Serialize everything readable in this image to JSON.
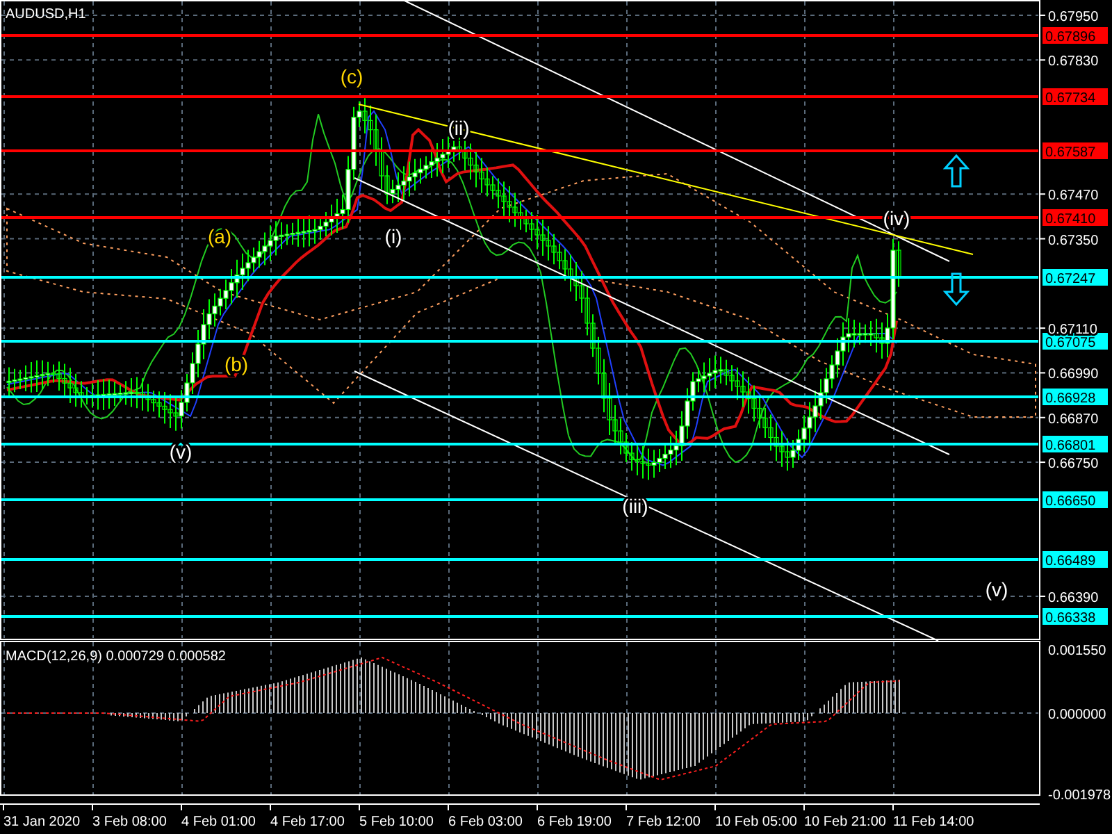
{
  "chart": {
    "title": "AUDUSD,H1"
  },
  "price_axis": [
    "0.67950",
    "0.67830",
    "0.67470",
    "0.67350",
    "0.67110",
    "0.66990",
    "0.66870",
    "0.66750",
    "0.66390"
  ],
  "price_levels": [
    {
      "label": "0.67896",
      "color": "#ff0000"
    },
    {
      "label": "0.67734",
      "color": "#ff0000"
    },
    {
      "label": "0.67587",
      "color": "#ff0000"
    },
    {
      "label": "0.67410",
      "color": "#ff0000"
    },
    {
      "label": "0.67247",
      "color": "#00ffff"
    },
    {
      "label": "0.67075",
      "color": "#00ffff"
    },
    {
      "label": "0.66928",
      "color": "#00ffff"
    },
    {
      "label": "0.66801",
      "color": "#00ffff"
    },
    {
      "label": "0.66650",
      "color": "#00ffff"
    },
    {
      "label": "0.66489",
      "color": "#00ffff"
    },
    {
      "label": "0.66338",
      "color": "#00ffff"
    }
  ],
  "wave_labels": [
    {
      "label": "(c)",
      "color": "#ffd700"
    },
    {
      "label": "(a)",
      "color": "#ffd700"
    },
    {
      "label": "(b)",
      "color": "#ffd700"
    },
    {
      "label": "(v)",
      "color": "#ffffff"
    },
    {
      "label": "(i)",
      "color": "#ffffff"
    },
    {
      "label": "(ii)",
      "color": "#ffffff"
    },
    {
      "label": "(iii)",
      "color": "#ffffff"
    },
    {
      "label": "(iv)",
      "color": "#ffffff"
    },
    {
      "label": "(v)",
      "color": "#ffffff"
    }
  ],
  "signal_arrows": [
    {
      "kind": "up"
    },
    {
      "kind": "down"
    }
  ],
  "macd": {
    "label": "MACD(12,26,9) 0.000729 0.000582",
    "scale": [
      "0.001550",
      "0.000000",
      "-0.001978"
    ]
  },
  "time_axis": [
    "31 Jan 2020",
    "3 Feb 08:00",
    "4 Feb 01:00",
    "4 Feb 17:00",
    "5 Feb 10:00",
    "6 Feb 03:00",
    "6 Feb 19:00",
    "7 Feb 12:00",
    "10 Feb 05:00",
    "10 Feb 21:00",
    "11 Feb 14:00"
  ]
}
